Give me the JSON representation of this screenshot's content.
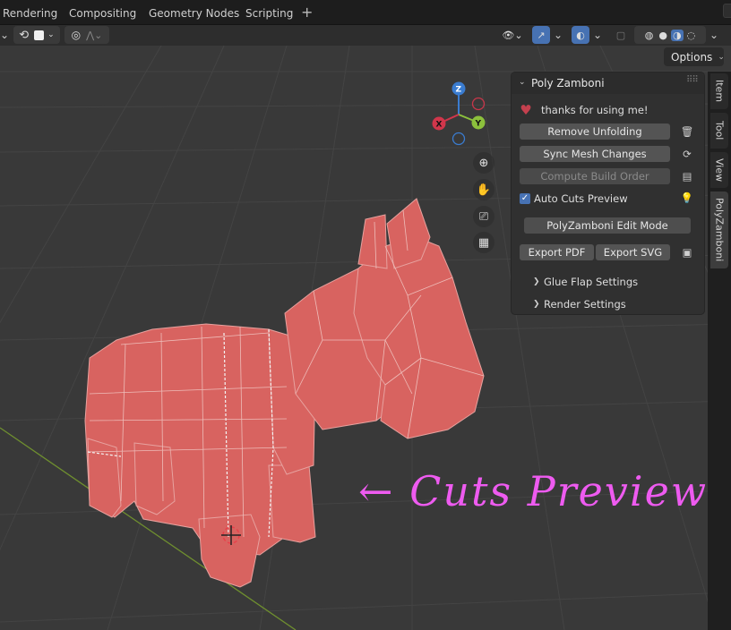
{
  "workspace_tabs": [
    "Rendering",
    "Compositing",
    "Geometry Nodes",
    "Scripting"
  ],
  "add_tab_label": "+",
  "options_label": "Options",
  "panel": {
    "title": "Poly Zamboni",
    "thanks": "thanks for using me!",
    "remove_unfolding": "Remove Unfolding",
    "sync_mesh": "Sync Mesh Changes",
    "compute_build_order": "Compute Build Order",
    "auto_cuts_preview": "Auto Cuts Preview",
    "edit_mode": "PolyZamboni Edit Mode",
    "export_pdf": "Export PDF",
    "export_svg": "Export SVG",
    "glue_flap_settings": "Glue Flap Settings",
    "render_settings": "Render Settings"
  },
  "side_tabs": [
    "Item",
    "Tool",
    "View",
    "PolyZamboni"
  ],
  "gizmo": {
    "z": "Z",
    "y": "Y",
    "x": "X"
  },
  "annotation": "← Cuts Preview",
  "colors": {
    "mesh": "#d86360",
    "annotation": "#ee5bf0",
    "accent": "#4772b3",
    "heart": "#c4404e"
  }
}
